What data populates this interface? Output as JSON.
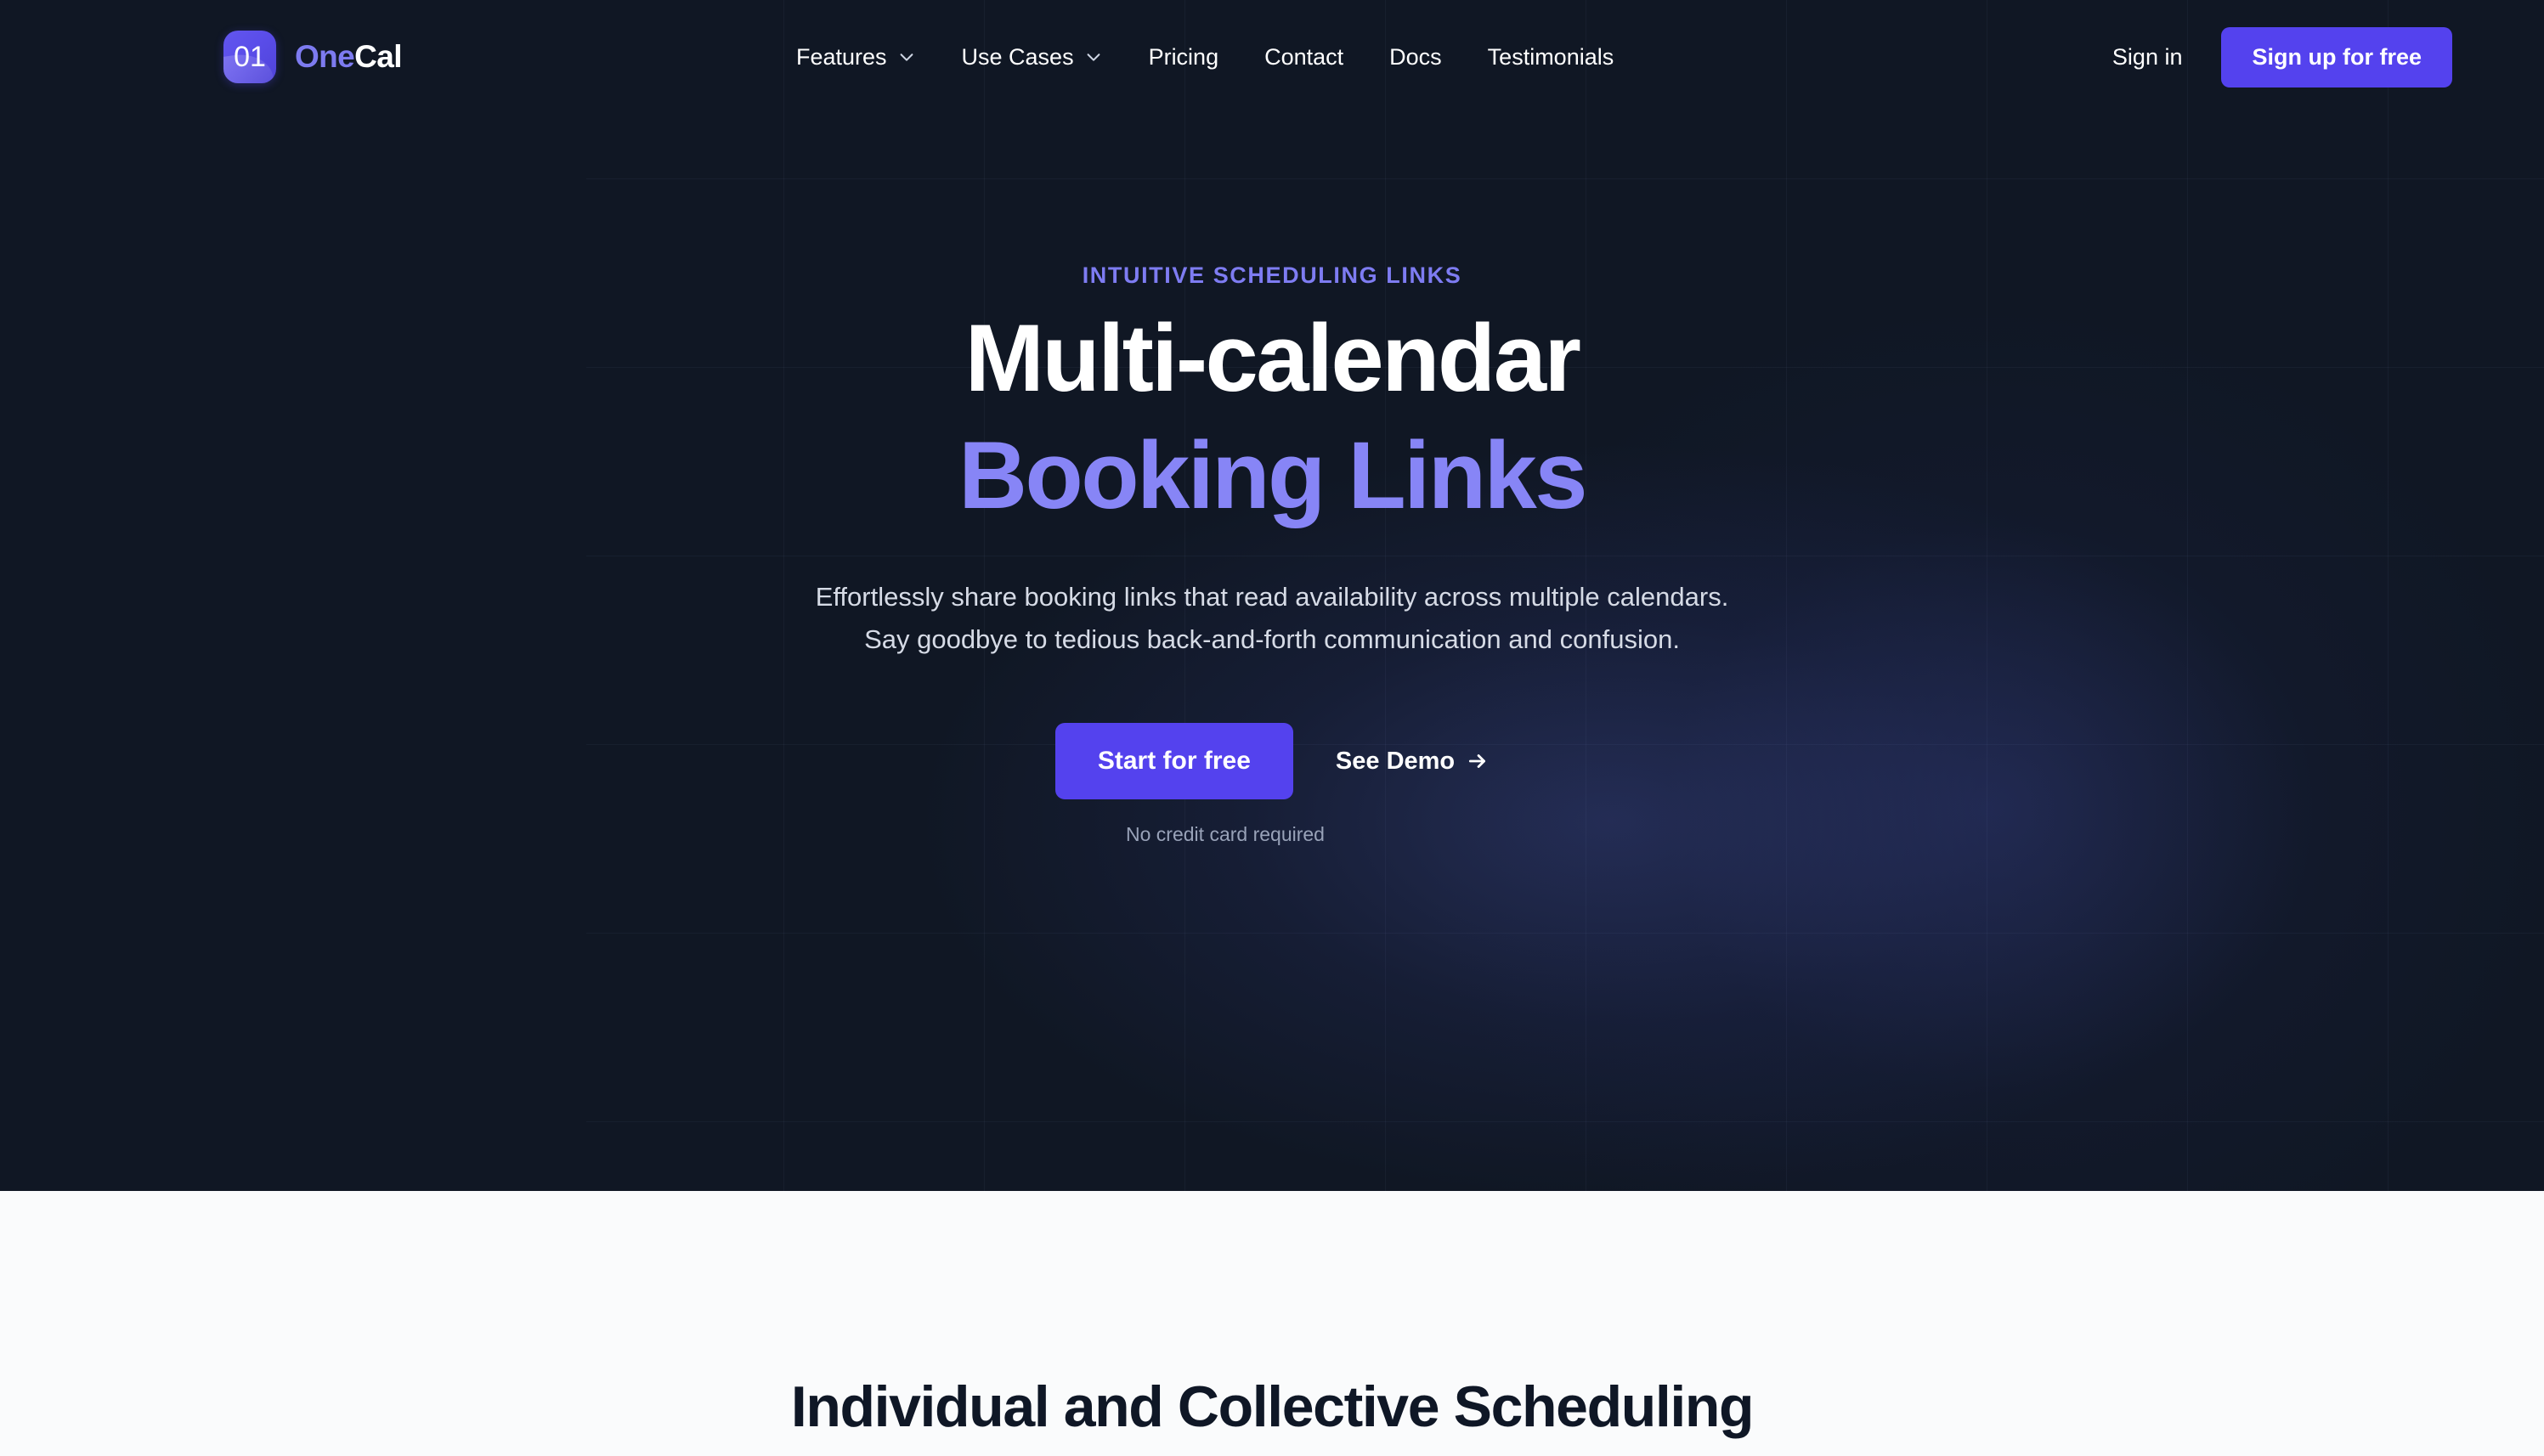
{
  "brand": {
    "mark_text": "01",
    "name_part1": "One",
    "name_part2": "Cal",
    "accent_color": "#5442ee",
    "logo_text_color": "#7d7bf0"
  },
  "nav": {
    "items": [
      {
        "label": "Features",
        "has_dropdown": true,
        "icon": "chevron-down-icon"
      },
      {
        "label": "Use Cases",
        "has_dropdown": true,
        "icon": "chevron-down-icon"
      },
      {
        "label": "Pricing",
        "has_dropdown": false
      },
      {
        "label": "Contact",
        "has_dropdown": false
      },
      {
        "label": "Docs",
        "has_dropdown": false
      },
      {
        "label": "Testimonials",
        "has_dropdown": false
      }
    ],
    "sign_in_label": "Sign in",
    "sign_up_label": "Sign up for free"
  },
  "hero": {
    "eyebrow": "INTUITIVE SCHEDULING LINKS",
    "headline_line1": "Multi-calendar",
    "headline_line2": "Booking Links",
    "headline_line1_color": "#ffffff",
    "headline_line2_color": "#8785f6",
    "subtitle_line1": "Effortlessly share booking links that read availability across multiple calendars.",
    "subtitle_line2": "Say goodbye to tedious back-and-forth communication and confusion.",
    "primary_cta": "Start for free",
    "secondary_cta": "See Demo",
    "secondary_cta_icon": "arrow-right-icon",
    "note": "No credit card required",
    "background_color": "#101724"
  },
  "section_scheduling": {
    "heading": "Individual and Collective Scheduling",
    "background_color": "#fafbfc",
    "heading_color": "#0f1726"
  }
}
